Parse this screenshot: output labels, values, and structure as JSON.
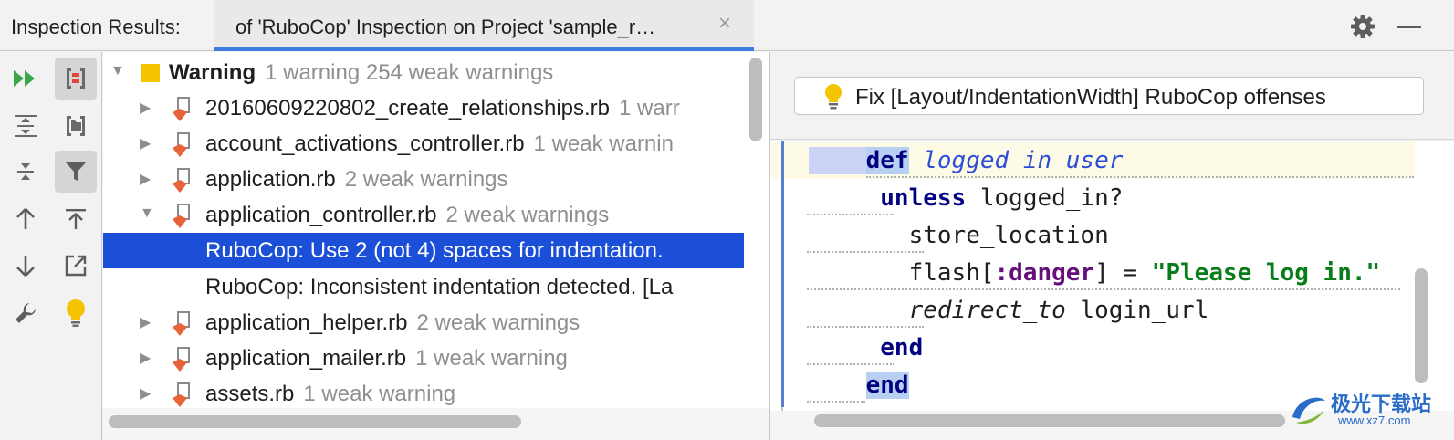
{
  "header": {
    "title": "Inspection Results:",
    "tab_label": "of 'RuboCop' Inspection on Project 'sample_r…",
    "tab_close": "×"
  },
  "toolbar": {
    "buttons": [
      "rerun-icon",
      "group-by-severity-icon",
      "expand-all-icon",
      "group-by-directory-icon",
      "collapse-all-icon",
      "filter-icon",
      "previous-icon",
      "export-icon",
      "next-icon",
      "autoscroll-icon",
      "settings-wrench-icon",
      "quick-fix-bulb-icon"
    ]
  },
  "tree": {
    "rows": [
      {
        "name": "Warning",
        "detail": "1 warning 254 weak warnings"
      },
      {
        "name": "20160609220802_create_relationships.rb",
        "detail": "1 warr"
      },
      {
        "name": "account_activations_controller.rb",
        "detail": "1 weak warnin"
      },
      {
        "name": "application.rb",
        "detail": "2 weak warnings"
      },
      {
        "name": "application_controller.rb",
        "detail": "2 weak warnings"
      },
      {
        "name": "RuboCop: Use 2 (not 4) spaces for indentation."
      },
      {
        "name": "RuboCop: Inconsistent indentation detected. [La"
      },
      {
        "name": "application_helper.rb",
        "detail": "2 weak warnings"
      },
      {
        "name": "application_mailer.rb",
        "detail": "1 weak warning"
      },
      {
        "name": "assets.rb",
        "detail": "1 weak warning"
      }
    ]
  },
  "fix": {
    "label": "Fix [Layout/IndentationWidth] RuboCop offenses"
  },
  "code": {
    "line1_kw": "def",
    "line1_name": "logged_in_user",
    "line2_kw": "unless",
    "line2_rest": " logged_in?",
    "line3": "store_location",
    "line4_a": "flash[",
    "line4_sym": ":danger",
    "line4_b": "] = ",
    "line4_str": "\"Please log in.\"",
    "line5_it": "redirect_to",
    "line5_rest": " login_url",
    "line6_kw": "end",
    "line7_kw": "end"
  },
  "watermark": {
    "text": "极光下载站",
    "url": "www.xz7.com"
  },
  "colors": {
    "accent": "#3f7de3",
    "selection": "#1c4fd8",
    "warning_yellow": "#f5c400",
    "file_icon_orange": "#e8623a"
  }
}
